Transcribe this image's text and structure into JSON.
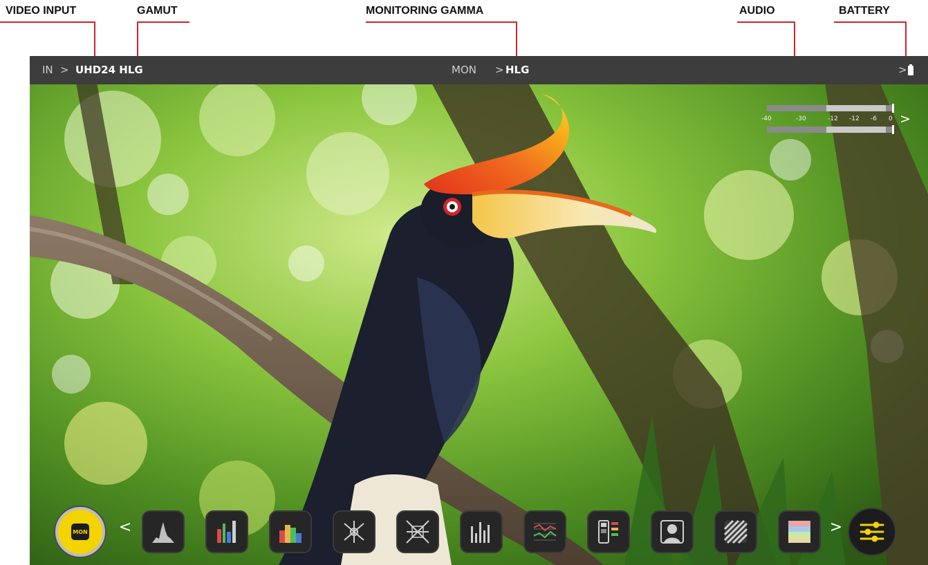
{
  "callouts": {
    "video_input": "VIDEO INPUT",
    "gamut": "GAMUT",
    "monitoring_gamma": "MONITORING GAMMA",
    "audio": "AUDIO",
    "battery": "BATTERY"
  },
  "status_bar": {
    "input_label": "IN",
    "arrow": ">",
    "input_value": "UHD24 HLG",
    "mon_label": "MON",
    "mon_value": "HLG",
    "battery_arrow": ">"
  },
  "audio_meter": {
    "scale": [
      "-40",
      "-30",
      "-12",
      "-12",
      "-6",
      "0"
    ],
    "more": ">"
  },
  "toolbar": {
    "mode_button": "MON",
    "prev": "<",
    "next": ">",
    "tools": [
      "histogram-icon",
      "rgb-parade-icon",
      "waveform-rgb-icon",
      "vectorscope-icon",
      "vectorscope-zoom-icon",
      "luma-parade-icon",
      "waveform-grid-icon",
      "false-color-icon",
      "skin-tone-icon",
      "zebra-icon",
      "color-bars-icon"
    ],
    "settings_icon": "sliders-icon"
  },
  "colors": {
    "accent": "#f4d400",
    "callout_red": "#d2232a",
    "status_bar_bg": "#3d3d3d"
  },
  "photo": {
    "subject": "bird-on-branch"
  }
}
